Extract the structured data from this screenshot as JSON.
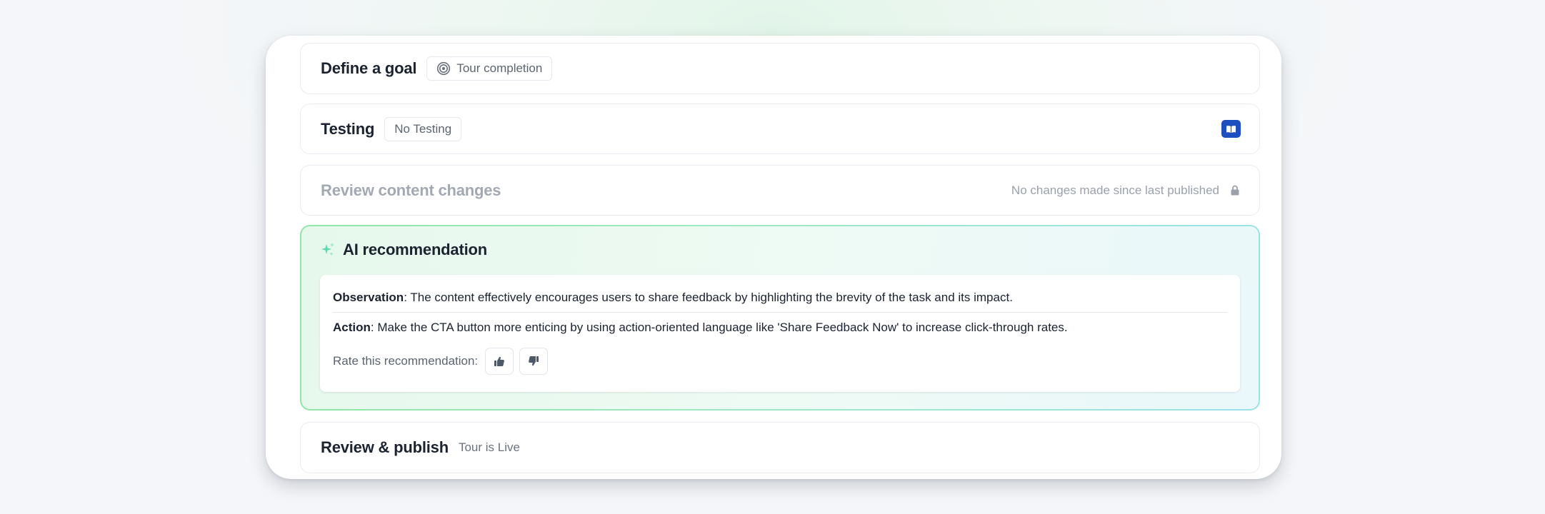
{
  "goal": {
    "title": "Define a goal",
    "value": "Tour completion",
    "icon": "target-icon"
  },
  "testing": {
    "title": "Testing",
    "value": "No Testing",
    "action_icon": "book-icon",
    "action_color": "#1f4fbf"
  },
  "review_changes": {
    "title": "Review content changes",
    "status": "No changes made since last published",
    "icon": "lock-icon"
  },
  "ai": {
    "title": "AI recommendation",
    "icon": "sparkle-icon",
    "observation_label": "Observation",
    "observation_sep": ":",
    "observation_text": " The content effectively encourages users to share feedback by highlighting the brevity of the task and its impact.",
    "action_label": "Action",
    "action_sep": ":",
    "action_text": " Make the CTA button more enticing by using action-oriented language like 'Share Feedback Now' to increase click-through rates.",
    "rate_label": "Rate this recommendation:",
    "thumbs_up_icon": "thumbs-up-icon",
    "thumbs_down_icon": "thumbs-down-icon",
    "accent_green": "#8fe6a6",
    "accent_cyan": "#99e3ea"
  },
  "publish": {
    "title": "Review & publish",
    "status": "Tour is Live"
  }
}
